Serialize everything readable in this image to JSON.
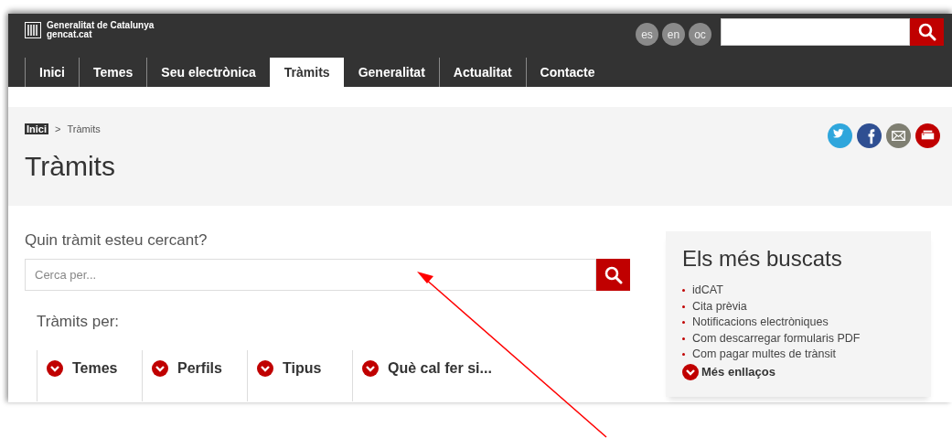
{
  "header": {
    "brand": {
      "name": "Generalitat de Catalunya",
      "site": "gencat.cat"
    },
    "languages": [
      "es",
      "en",
      "oc"
    ]
  },
  "nav": [
    {
      "label": "Inici",
      "selected": false
    },
    {
      "label": "Temes",
      "selected": false
    },
    {
      "label": "Seu electrònica",
      "selected": false
    },
    {
      "label": "Tràmits",
      "selected": true
    },
    {
      "label": "Generalitat",
      "selected": false
    },
    {
      "label": "Actualitat",
      "selected": false
    },
    {
      "label": "Contacte",
      "selected": false
    }
  ],
  "breadcrumb": {
    "items": [
      {
        "label": "Inici",
        "kind": "link"
      },
      {
        "label": "Tràmits",
        "kind": "current"
      }
    ],
    "separator": ">"
  },
  "page_title": "Tràmits",
  "share": [
    {
      "kind": "twitter"
    },
    {
      "kind": "facebook"
    },
    {
      "kind": "email"
    },
    {
      "kind": "print"
    }
  ],
  "search": {
    "label": "Quin tràmit esteu cercant?",
    "placeholder": "Cerca per..."
  },
  "browse": {
    "label": "Tràmits per:",
    "options": [
      "Temes",
      "Perfils",
      "Tipus",
      "Què cal fer si..."
    ]
  },
  "sidebar": {
    "title": "Els més buscats",
    "links": [
      "idCAT",
      "Cita prèvia",
      "Notificacions electròniques",
      "Com descarregar formularis PDF",
      "Com pagar multes de trànsit"
    ],
    "more": "Més enllaços"
  }
}
